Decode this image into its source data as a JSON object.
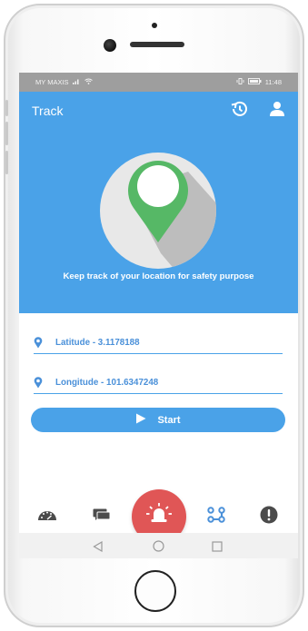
{
  "status_bar": {
    "carrier": "MY MAXIS",
    "time": "11:48"
  },
  "app_bar": {
    "title": "Track",
    "history_icon": "history-icon",
    "profile_icon": "person-icon"
  },
  "hero": {
    "illustration_icon": "map-pin-icon",
    "tagline": "Keep track of your location for safety purpose"
  },
  "fields": {
    "latitude": "Latitude - 3.1178188",
    "longitude": "Longitude - 101.6347248"
  },
  "start_button": {
    "label": "Start",
    "icon": "play-icon"
  },
  "bottom_nav": {
    "items": [
      {
        "icon": "speedometer-icon"
      },
      {
        "icon": "chat-icon"
      },
      {
        "icon": "alarm-bell-icon"
      },
      {
        "icon": "route-icon",
        "active": true
      },
      {
        "icon": "alert-icon"
      }
    ]
  },
  "colors": {
    "primary": "#4aa2e8",
    "alarm": "#e05656",
    "inactive_icon": "#4b4b4b"
  }
}
